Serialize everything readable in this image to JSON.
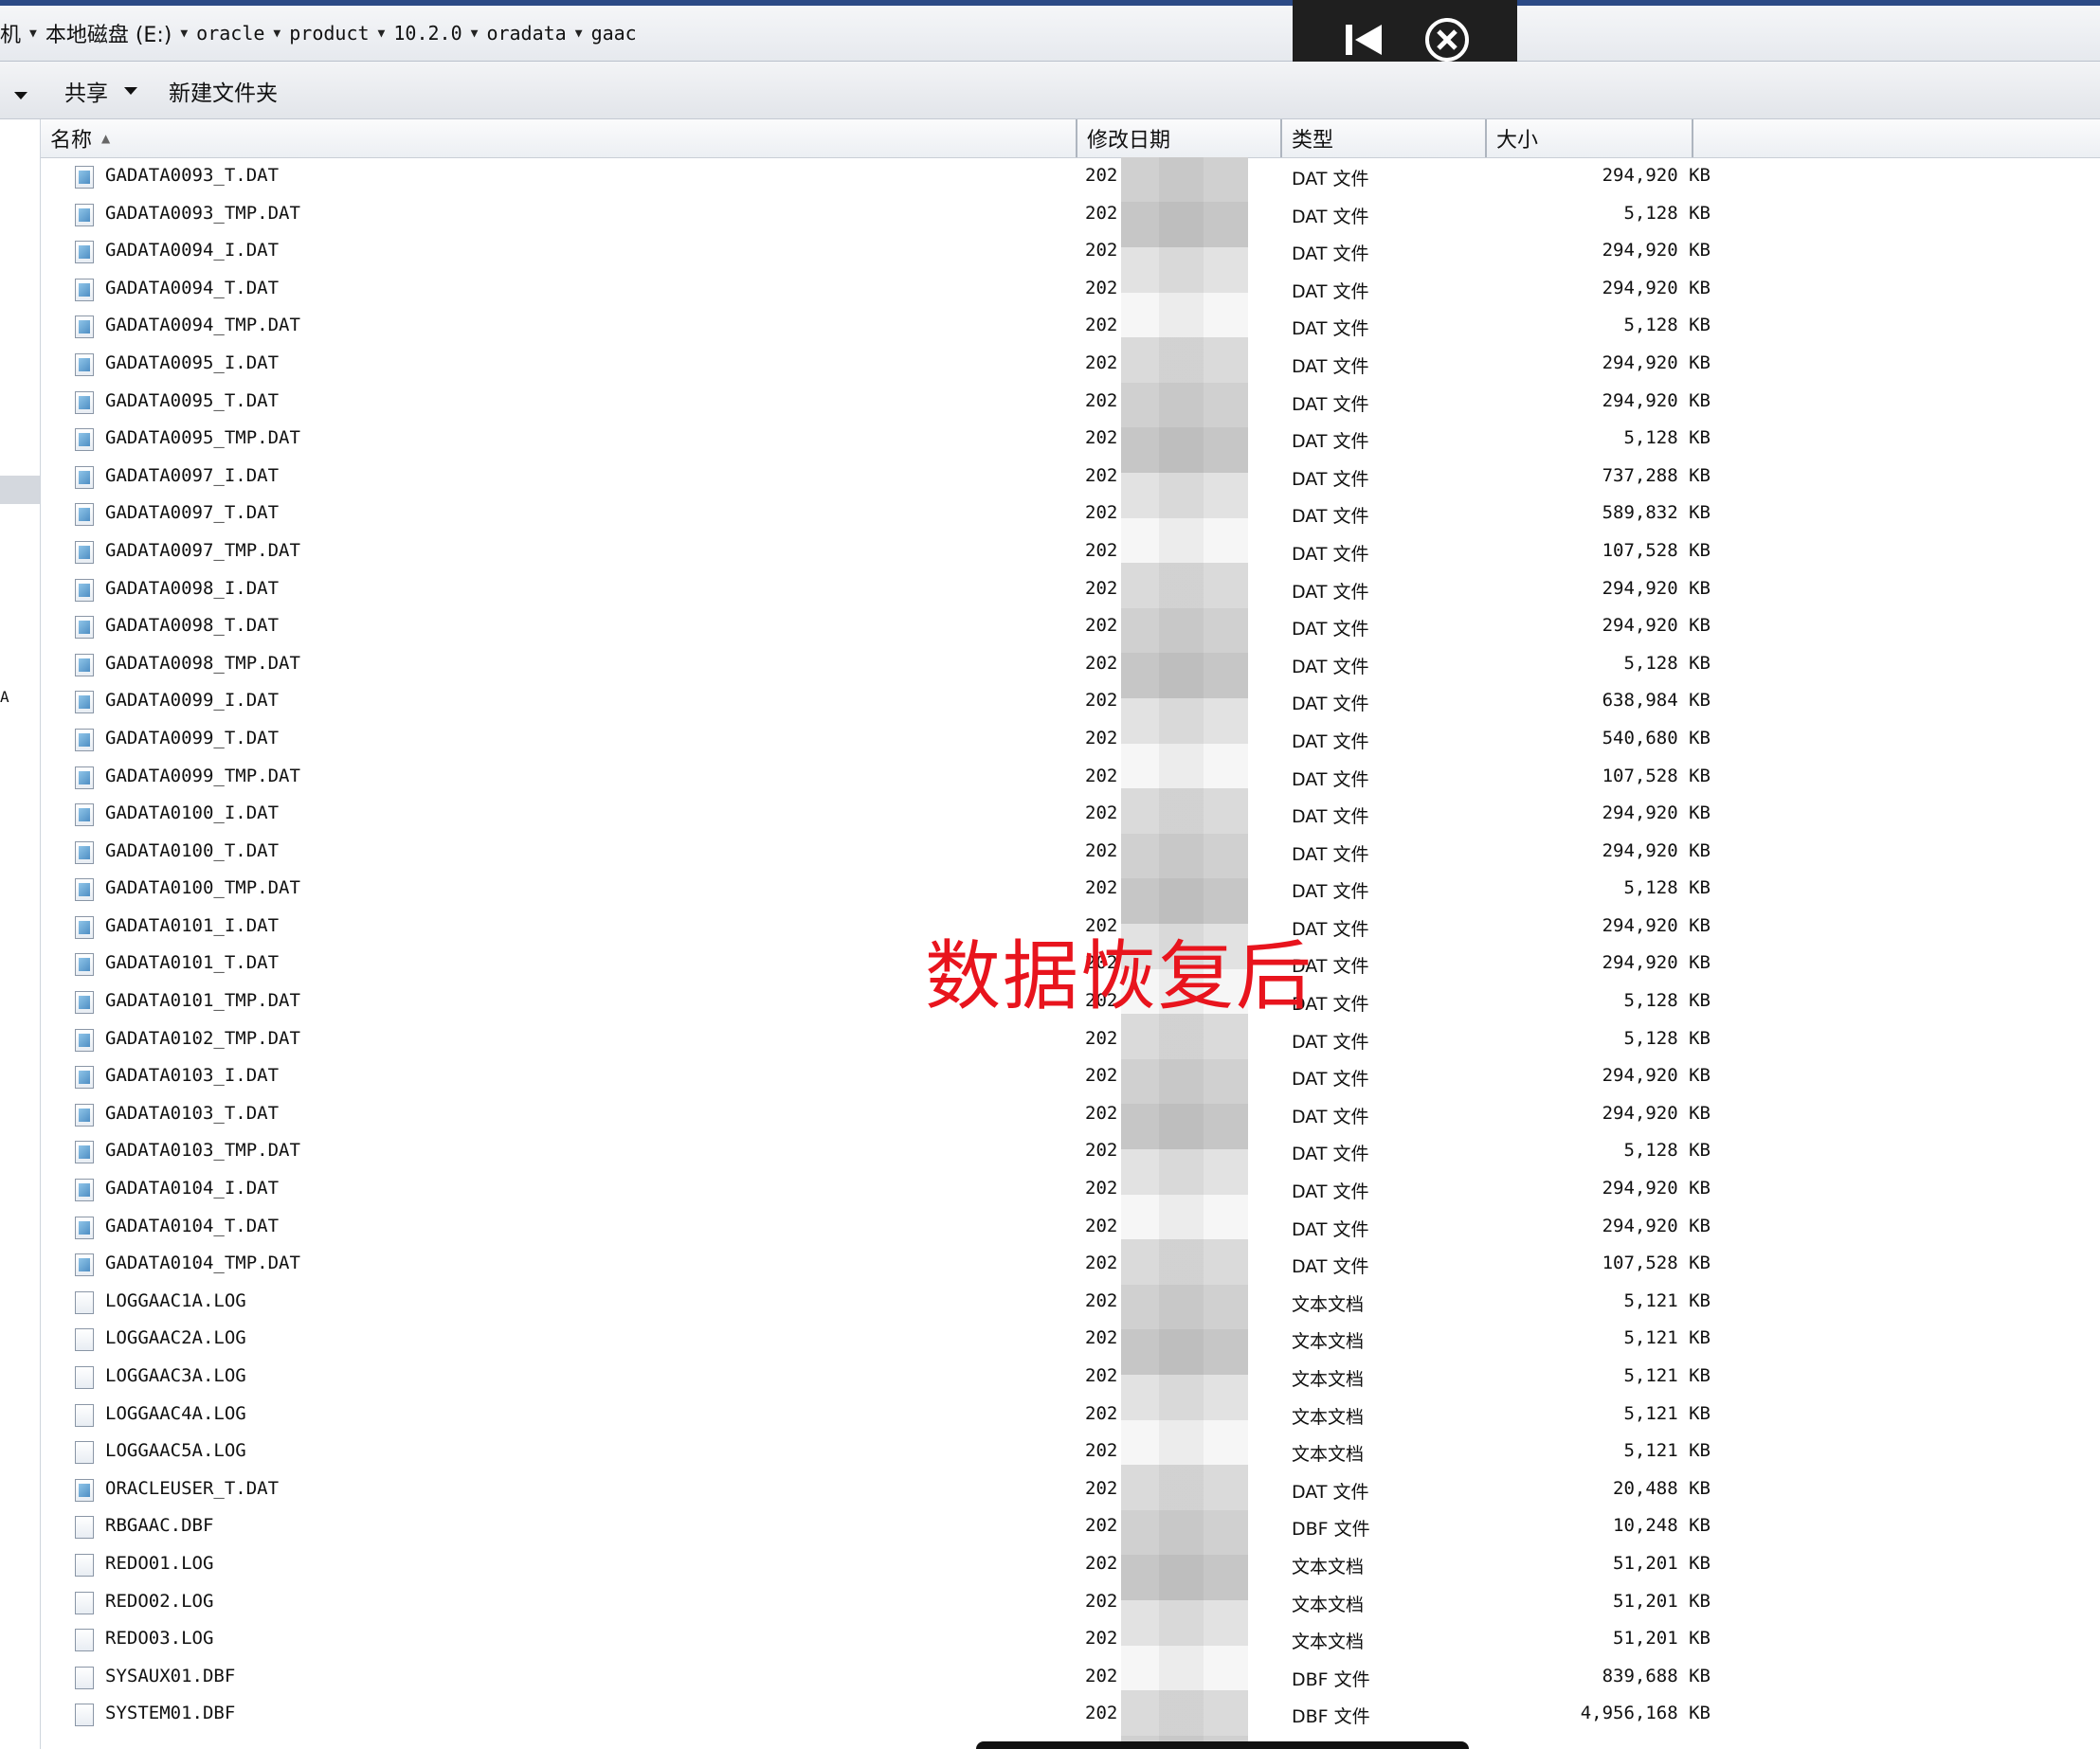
{
  "address": {
    "crumbs": [
      "机",
      "本地磁盘 (E:)",
      "oracle",
      "product",
      "10.2.0",
      "oradata",
      "gaac"
    ]
  },
  "toolbar": {
    "share_label": "共享",
    "new_folder_label": "新建文件夹"
  },
  "columns": {
    "name": "名称",
    "date": "修改日期",
    "type": "类型",
    "size": "大小"
  },
  "watermark": "数据恢复后",
  "left_stub": "A",
  "files": [
    {
      "name": "GADATA0093_T.DAT",
      "date": "202",
      "type": "DAT 文件",
      "size": "294,920 KB",
      "icon": "dat-file-icon"
    },
    {
      "name": "GADATA0093_TMP.DAT",
      "date": "202",
      "type": "DAT 文件",
      "size": "5,128 KB",
      "icon": "dat-file-icon"
    },
    {
      "name": "GADATA0094_I.DAT",
      "date": "202",
      "type": "DAT 文件",
      "size": "294,920 KB",
      "icon": "dat-file-icon"
    },
    {
      "name": "GADATA0094_T.DAT",
      "date": "202",
      "type": "DAT 文件",
      "size": "294,920 KB",
      "icon": "dat-file-icon"
    },
    {
      "name": "GADATA0094_TMP.DAT",
      "date": "202",
      "type": "DAT 文件",
      "size": "5,128 KB",
      "icon": "dat-file-icon"
    },
    {
      "name": "GADATA0095_I.DAT",
      "date": "202",
      "type": "DAT 文件",
      "size": "294,920 KB",
      "icon": "dat-file-icon"
    },
    {
      "name": "GADATA0095_T.DAT",
      "date": "202",
      "type": "DAT 文件",
      "size": "294,920 KB",
      "icon": "dat-file-icon"
    },
    {
      "name": "GADATA0095_TMP.DAT",
      "date": "202",
      "type": "DAT 文件",
      "size": "5,128 KB",
      "icon": "dat-file-icon"
    },
    {
      "name": "GADATA0097_I.DAT",
      "date": "202",
      "type": "DAT 文件",
      "size": "737,288 KB",
      "icon": "dat-file-icon"
    },
    {
      "name": "GADATA0097_T.DAT",
      "date": "202",
      "type": "DAT 文件",
      "size": "589,832 KB",
      "icon": "dat-file-icon"
    },
    {
      "name": "GADATA0097_TMP.DAT",
      "date": "202",
      "type": "DAT 文件",
      "size": "107,528 KB",
      "icon": "dat-file-icon"
    },
    {
      "name": "GADATA0098_I.DAT",
      "date": "202",
      "type": "DAT 文件",
      "size": "294,920 KB",
      "icon": "dat-file-icon"
    },
    {
      "name": "GADATA0098_T.DAT",
      "date": "202",
      "type": "DAT 文件",
      "size": "294,920 KB",
      "icon": "dat-file-icon"
    },
    {
      "name": "GADATA0098_TMP.DAT",
      "date": "202",
      "type": "DAT 文件",
      "size": "5,128 KB",
      "icon": "dat-file-icon"
    },
    {
      "name": "GADATA0099_I.DAT",
      "date": "202",
      "type": "DAT 文件",
      "size": "638,984 KB",
      "icon": "dat-file-icon"
    },
    {
      "name": "GADATA0099_T.DAT",
      "date": "202",
      "type": "DAT 文件",
      "size": "540,680 KB",
      "icon": "dat-file-icon"
    },
    {
      "name": "GADATA0099_TMP.DAT",
      "date": "202",
      "type": "DAT 文件",
      "size": "107,528 KB",
      "icon": "dat-file-icon"
    },
    {
      "name": "GADATA0100_I.DAT",
      "date": "202",
      "type": "DAT 文件",
      "size": "294,920 KB",
      "icon": "dat-file-icon"
    },
    {
      "name": "GADATA0100_T.DAT",
      "date": "202",
      "type": "DAT 文件",
      "size": "294,920 KB",
      "icon": "dat-file-icon"
    },
    {
      "name": "GADATA0100_TMP.DAT",
      "date": "202",
      "type": "DAT 文件",
      "size": "5,128 KB",
      "icon": "dat-file-icon"
    },
    {
      "name": "GADATA0101_I.DAT",
      "date": "202",
      "type": "DAT 文件",
      "size": "294,920 KB",
      "icon": "dat-file-icon"
    },
    {
      "name": "GADATA0101_T.DAT",
      "date": "202",
      "type": "DAT 文件",
      "size": "294,920 KB",
      "icon": "dat-file-icon"
    },
    {
      "name": "GADATA0101_TMP.DAT",
      "date": "202",
      "type": "DAT 文件",
      "size": "5,128 KB",
      "icon": "dat-file-icon"
    },
    {
      "name": "GADATA0102_TMP.DAT",
      "date": "202",
      "type": "DAT 文件",
      "size": "5,128 KB",
      "icon": "dat-file-icon"
    },
    {
      "name": "GADATA0103_I.DAT",
      "date": "202",
      "type": "DAT 文件",
      "size": "294,920 KB",
      "icon": "dat-file-icon"
    },
    {
      "name": "GADATA0103_T.DAT",
      "date": "202",
      "type": "DAT 文件",
      "size": "294,920 KB",
      "icon": "dat-file-icon"
    },
    {
      "name": "GADATA0103_TMP.DAT",
      "date": "202",
      "type": "DAT 文件",
      "size": "5,128 KB",
      "icon": "dat-file-icon"
    },
    {
      "name": "GADATA0104_I.DAT",
      "date": "202",
      "type": "DAT 文件",
      "size": "294,920 KB",
      "icon": "dat-file-icon"
    },
    {
      "name": "GADATA0104_T.DAT",
      "date": "202",
      "type": "DAT 文件",
      "size": "294,920 KB",
      "icon": "dat-file-icon"
    },
    {
      "name": "GADATA0104_TMP.DAT",
      "date": "202",
      "type": "DAT 文件",
      "size": "107,528 KB",
      "icon": "dat-file-icon"
    },
    {
      "name": "LOGGAAC1A.LOG",
      "date": "202",
      "type": "文本文档",
      "size": "5,121 KB",
      "icon": "text-file-icon"
    },
    {
      "name": "LOGGAAC2A.LOG",
      "date": "202",
      "type": "文本文档",
      "size": "5,121 KB",
      "icon": "text-file-icon"
    },
    {
      "name": "LOGGAAC3A.LOG",
      "date": "202",
      "type": "文本文档",
      "size": "5,121 KB",
      "icon": "text-file-icon"
    },
    {
      "name": "LOGGAAC4A.LOG",
      "date": "202",
      "type": "文本文档",
      "size": "5,121 KB",
      "icon": "text-file-icon"
    },
    {
      "name": "LOGGAAC5A.LOG",
      "date": "202",
      "type": "文本文档",
      "size": "5,121 KB",
      "icon": "text-file-icon"
    },
    {
      "name": "ORACLEUSER_T.DAT",
      "date": "202",
      "type": "DAT 文件",
      "size": "20,488 KB",
      "icon": "dat-file-icon"
    },
    {
      "name": "RBGAAC.DBF",
      "date": "202",
      "type": "DBF 文件",
      "size": "10,248 KB",
      "icon": "file-icon"
    },
    {
      "name": "REDO01.LOG",
      "date": "202",
      "type": "文本文档",
      "size": "51,201 KB",
      "icon": "text-file-icon"
    },
    {
      "name": "REDO02.LOG",
      "date": "202",
      "type": "文本文档",
      "size": "51,201 KB",
      "icon": "text-file-icon"
    },
    {
      "name": "REDO03.LOG",
      "date": "202",
      "type": "文本文档",
      "size": "51,201 KB",
      "icon": "text-file-icon"
    },
    {
      "name": "SYSAUX01.DBF",
      "date": "202",
      "type": "DBF 文件",
      "size": "839,688 KB",
      "icon": "file-icon"
    },
    {
      "name": "SYSTEM01.DBF",
      "date": "202",
      "type": "DBF 文件",
      "size": "4,956,168 KB",
      "icon": "file-icon"
    }
  ]
}
